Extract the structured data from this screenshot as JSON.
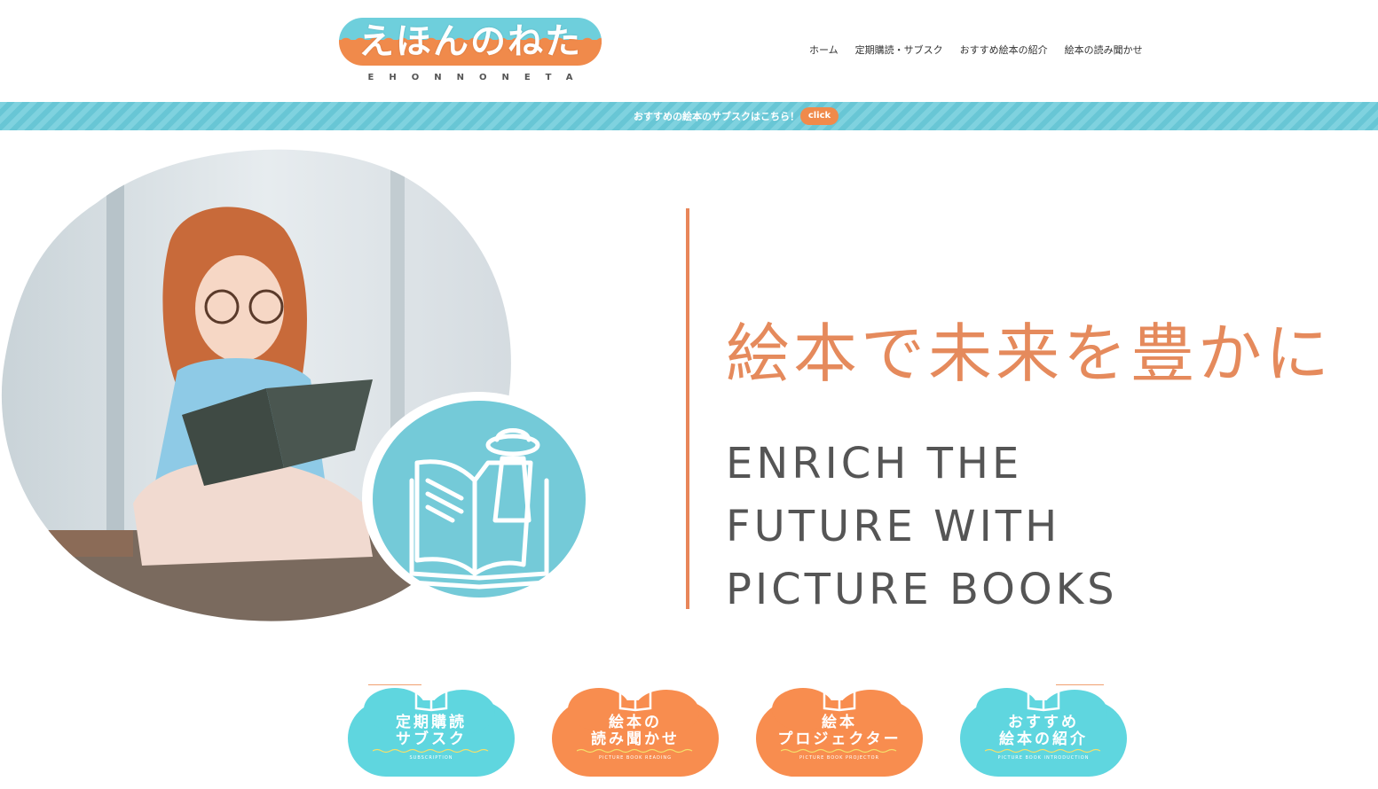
{
  "header": {
    "logo_text": "えほんのねた",
    "logo_sub": "EHONNONETA",
    "nav": [
      "ホーム",
      "定期購読・サブスク",
      "おすすめ絵本の紹介",
      "絵本の読み聞かせ"
    ]
  },
  "banner": {
    "text": "おすすめの絵本のサブスクはこちら！",
    "button": "click"
  },
  "hero": {
    "jp_title": "絵本で未来を豊かに",
    "en_title": "ENRICH THE\nFUTURE WITH\nPICTURE BOOKS"
  },
  "cards": [
    {
      "title1": "定期購読",
      "title2": "サブスク",
      "sub": "SUBSCRIPTION",
      "color": "#5fd6df"
    },
    {
      "title1": "絵本の",
      "title2": "読み聞かせ",
      "sub": "PICTURE BOOK READING",
      "color": "#f88d4f"
    },
    {
      "title1": "絵本",
      "title2": "プロジェクター",
      "sub": "PICTURE BOOK PROJECTOR",
      "color": "#f88d4f"
    },
    {
      "title1": "おすすめ",
      "title2": "絵本の紹介",
      "sub": "PICTURE BOOK INTRODUCTION",
      "color": "#5fd6df"
    }
  ],
  "colors": {
    "accent_orange": "#e8865a",
    "accent_blue": "#74cad8"
  },
  "icons": [
    "book-ufo-icon",
    "open-book-icon"
  ]
}
